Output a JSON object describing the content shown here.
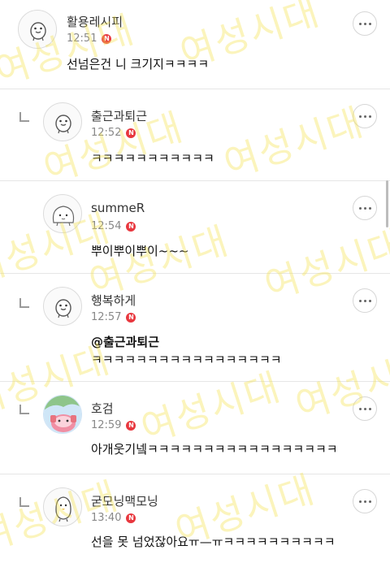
{
  "comments": [
    {
      "nickname": "활용레시피",
      "time": "12:51",
      "badge": "N",
      "text": "선넘은건 니 크기지ㅋㅋㅋㅋ",
      "reply": false,
      "avatar": "pigeon-avatar"
    },
    {
      "nickname": "출근과퇴근",
      "time": "12:52",
      "badge": "N",
      "text": "ㅋㅋㅋㅋㅋㅋㅋㅋㅋㅋㅋ",
      "reply": true,
      "avatar": "pigeon-avatar"
    },
    {
      "nickname": "summeR",
      "time": "12:54",
      "badge": "N",
      "text": "뿌이뿌이뿌이~~~",
      "reply": false,
      "avatar": "blob-avatar"
    },
    {
      "nickname": "행복하게",
      "time": "12:57",
      "badge": "N",
      "mention": "@출근과퇴근",
      "text": " ㅋㅋㅋㅋㅋㅋㅋㅋㅋㅋㅋㅋㅋㅋㅋㅋㅋ",
      "reply": true,
      "avatar": "pigeon-avatar"
    },
    {
      "nickname": "호검",
      "time": "12:59",
      "badge": "N",
      "text": "아개웃기넼ㅋㅋㅋㅋㅋㅋㅋㅋㅋㅋㅋㅋㅋㅋㅋㅋㅋ",
      "reply": true,
      "avatar": "photo-avatar"
    },
    {
      "nickname": "굳모닝맥모닝",
      "time": "13:40",
      "badge": "N",
      "text": "선을 못 넘었잖아요ㅠ—ㅠㅋㅋㅋㅋㅋㅋㅋㅋㅋㅋ",
      "reply": true,
      "avatar": "penguin-avatar"
    }
  ],
  "watermark": "여성시대",
  "colors": {
    "badge": "#e8373e",
    "watermark": "#f5e250"
  }
}
